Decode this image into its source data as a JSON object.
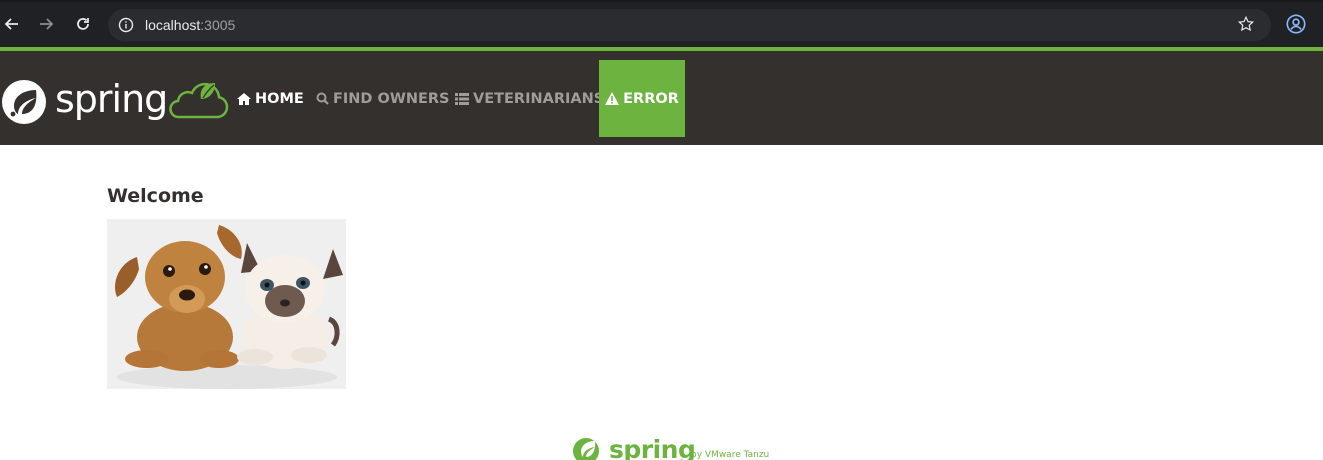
{
  "browser": {
    "url_host": "localhost",
    "url_port": ":3005"
  },
  "brand": {
    "name": "spring"
  },
  "nav": {
    "items": [
      {
        "label": "HOME",
        "icon": "home-icon"
      },
      {
        "label": "FIND OWNERS",
        "icon": "search-icon"
      },
      {
        "label": "VETERINARIANS",
        "icon": "list-icon"
      },
      {
        "label": "ERROR",
        "icon": "warning-icon"
      }
    ]
  },
  "main": {
    "title": "Welcome",
    "image": "pets-photo"
  },
  "footer": {
    "brand": "spring",
    "tagline": "by VMware Tanzu"
  },
  "colors": {
    "accent": "#6db33f",
    "navbar_bg": "#34302d",
    "browser_bg": "#202124"
  }
}
